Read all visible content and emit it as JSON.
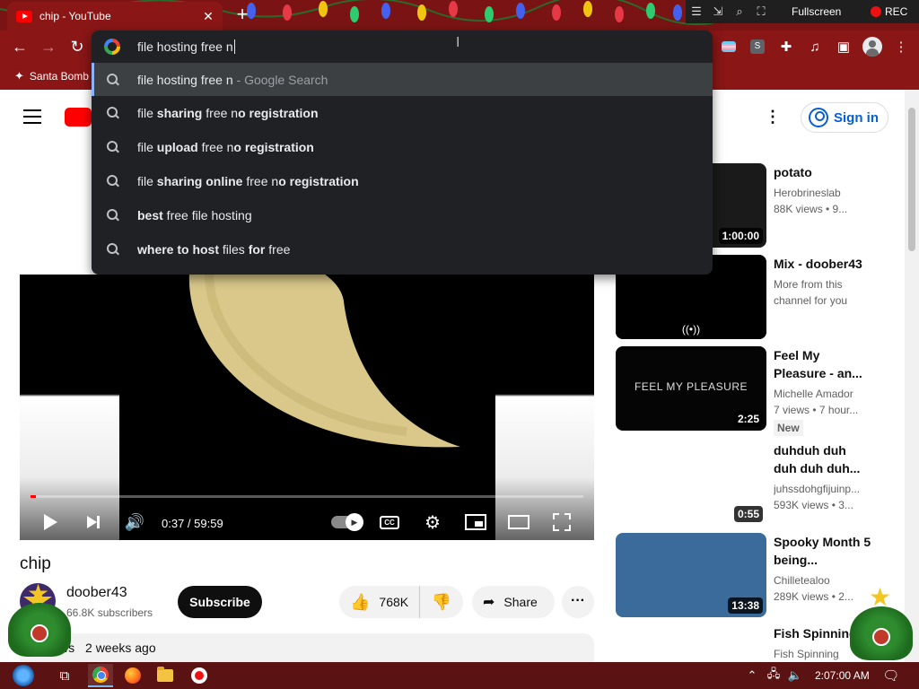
{
  "browser": {
    "tab_title": "chip - YouTube",
    "tab_close": "✕",
    "new_tab": "+",
    "bookmark": "Santa Bomb",
    "recorder": {
      "fullscreen_label": "Fullscreen",
      "rec_label": "REC"
    }
  },
  "omnibox": {
    "input_value": "file hosting free n",
    "suggestions": [
      {
        "parts": [
          {
            "t": "file hosting free n",
            "b": false
          },
          {
            "t": " - Google Search",
            "b": false,
            "dim": true
          }
        ],
        "selected": true
      },
      {
        "parts": [
          {
            "t": "file ",
            "b": false
          },
          {
            "t": "sharing",
            "b": true
          },
          {
            "t": " free n",
            "b": false
          },
          {
            "t": "o registration",
            "b": true
          }
        ]
      },
      {
        "parts": [
          {
            "t": "file ",
            "b": false
          },
          {
            "t": "upload",
            "b": true
          },
          {
            "t": " free n",
            "b": false
          },
          {
            "t": "o registration",
            "b": true
          }
        ]
      },
      {
        "parts": [
          {
            "t": "file ",
            "b": false
          },
          {
            "t": "sharing online",
            "b": true
          },
          {
            "t": " free n",
            "b": false
          },
          {
            "t": "o registration",
            "b": true
          }
        ]
      },
      {
        "parts": [
          {
            "t": "best",
            "b": true
          },
          {
            "t": " free file hosting",
            "b": false
          }
        ]
      },
      {
        "parts": [
          {
            "t": "where to host",
            "b": true
          },
          {
            "t": " files ",
            "b": false
          },
          {
            "t": "for",
            "b": true
          },
          {
            "t": " free",
            "b": false
          }
        ]
      }
    ]
  },
  "youtube": {
    "sign_in": "Sign in",
    "player": {
      "time": "0:37 / 59:59",
      "progress_fraction": 0.0103
    },
    "video": {
      "title": "chip",
      "channel": "doober43",
      "subscribers": "66.8K subscribers",
      "subscribe": "Subscribe",
      "likes": "768K",
      "share": "Share",
      "desc_views": "ws",
      "desc_age": "2 weeks ago"
    },
    "recommendations": [
      {
        "title": "potato",
        "channel": "Herobrineslab",
        "meta": "88K views • 9...",
        "duration": "1:00:00",
        "thumb": "#1a1a1a"
      },
      {
        "title": "Mix - doober43",
        "channel": "More from this",
        "meta": "channel for you",
        "duration": "",
        "thumb": "#000000"
      },
      {
        "title": "Feel My Pleasure - an...",
        "channel": "Michelle Amador",
        "meta": "7 views • 7 hour...",
        "badge": "New",
        "duration": "2:25",
        "thumb": "#050505",
        "thumb_text": "FEEL MY PLEASURE"
      },
      {
        "title": "duhduh duh duh duh duh...",
        "channel": "juhssdohgfijuinp...",
        "meta": "593K views • 3...",
        "duration": "0:55",
        "thumb": "#ffffff"
      },
      {
        "title": "Spooky Month 5 being...",
        "channel": "Chilletealoo",
        "meta": "289K views • 2...",
        "duration": "13:38",
        "thumb": "#3a6b9a"
      },
      {
        "title": "Fish Spinning",
        "channel": "Fish Spinning",
        "meta": "",
        "duration": "",
        "thumb": "#ffffff"
      }
    ]
  },
  "taskbar": {
    "clock": "2:07:00 AM"
  },
  "colors": {
    "chrome_bg": "#8a1616",
    "omnibox_bg": "#202124",
    "youtube_red": "#ff0000",
    "link_blue": "#065fd4"
  }
}
